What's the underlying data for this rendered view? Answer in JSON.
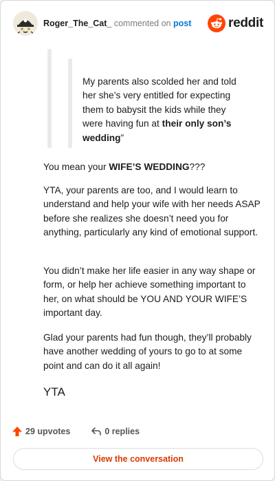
{
  "header": {
    "username": "Roger_The_Cat_",
    "verb": "commented on",
    "post_link": "post",
    "brand": "reddit"
  },
  "quote": {
    "text_before": "My parents also scolded her and told her she’s very entitled for expecting them to babysit the kids while they were having fun at ",
    "text_bold": "their only son’s wedding",
    "text_after": "”"
  },
  "comment": {
    "p1_before": "You mean your ",
    "p1_bold": "WIFE’S WEDDING",
    "p1_after": "???",
    "p2": "YTA, your parents are too, and I would learn to understand and help your wife with her needs ASAP before she realizes she doesn’t need you for anything, particularly any kind of emotional support.",
    "p3": "You didn’t make her life easier in any way shape or form, or help her achieve something important to her, on what should be YOU AND YOUR WIFE’S important day.",
    "p4": "Glad your parents had fun though, they’ll probably have another wedding of yours to go to at some point and can do it all again!",
    "p5": "YTA"
  },
  "footer": {
    "upvotes": "29 upvotes",
    "replies": "0 replies"
  },
  "cta": {
    "label": "View the conversation"
  },
  "colors": {
    "brand_orange": "#ff4500",
    "cta_text": "#d93a00",
    "link_blue": "#0079d3"
  }
}
